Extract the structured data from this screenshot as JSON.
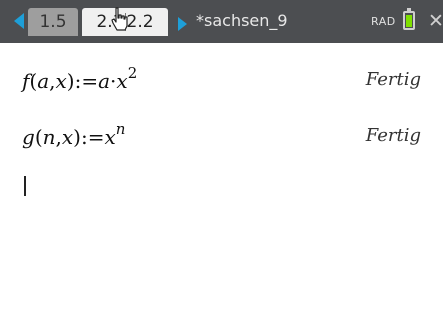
{
  "tabs": [
    {
      "label": "1.5"
    },
    {
      "label_left": "2.1",
      "label_right": "2.2"
    }
  ],
  "document": {
    "name": "*sachsen_9",
    "mode": "RAD"
  },
  "battery": {
    "level": 0.9,
    "color": "#7fe000"
  },
  "history": [
    {
      "entry_parts": {
        "f": "f",
        "open": "(",
        "a": "a",
        "comma": ",",
        "x": "x",
        "close": ")",
        "assign": ":=",
        "a2": "a",
        "dot": "·",
        "x2": "x",
        "exp": "2"
      },
      "result": "Fertig"
    },
    {
      "entry_parts": {
        "g": "g",
        "open": "(",
        "n": "n",
        "comma": ",",
        "x": "x",
        "close": ")",
        "assign": ":=",
        "x2": "x",
        "exp": "n"
      },
      "result": "Fertig"
    }
  ],
  "accent_color": "#1e9fd8",
  "icons": [
    "nav-left-arrow-icon",
    "nav-right-arrow-icon",
    "hand-pointer-icon",
    "battery-icon",
    "close-icon"
  ]
}
